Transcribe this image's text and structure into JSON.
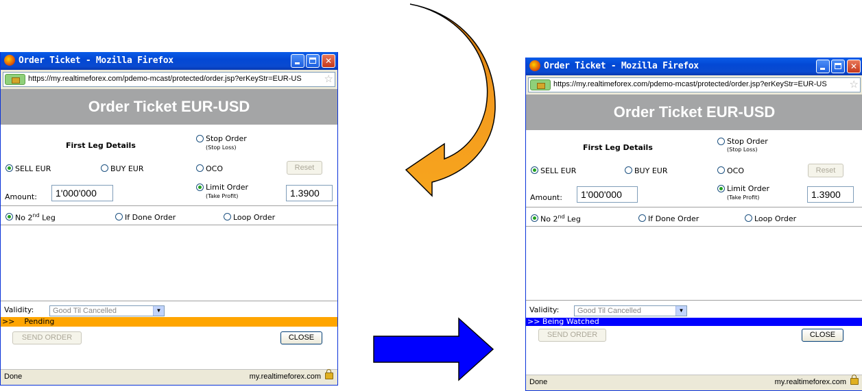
{
  "windows": [
    {
      "window_title": "Order Ticket - Mozilla Firefox",
      "url": "https://my.realtimeforex.com/pdemo-mcast/protected/order.jsp?erKeyStr=EUR-US",
      "header": "Order Ticket EUR-USD",
      "first_leg_label": "First Leg Details",
      "stop_order": "Stop Order",
      "stop_loss": "(Stop Loss)",
      "sell": "SELL EUR",
      "buy": "BUY EUR",
      "oco": "OCO",
      "reset": "Reset",
      "amount_label": "Amount:",
      "amount_value": "1'000'000",
      "limit_order": "Limit Order",
      "take_profit": "(Take Profit)",
      "price_value": "1.3900",
      "no_second_leg": "No 2",
      "no_second_leg_sup": "nd",
      "no_second_leg_tail": " Leg",
      "if_done": "If Done Order",
      "loop_order": "Loop Order",
      "validity_label": "Validity:",
      "validity_value": "Good Til Cancelled",
      "status_text": ">>    Pending",
      "send_order": "SEND ORDER",
      "close": "CLOSE",
      "footer_status": "Done",
      "footer_host": "my.realtimeforex.com"
    },
    {
      "window_title": "Order Ticket - Mozilla Firefox",
      "url": "https://my.realtimeforex.com/pdemo-mcast/protected/order.jsp?erKeyStr=EUR-US",
      "header": "Order Ticket EUR-USD",
      "first_leg_label": "First Leg Details",
      "stop_order": "Stop Order",
      "stop_loss": "(Stop Loss)",
      "sell": "SELL EUR",
      "buy": "BUY EUR",
      "oco": "OCO",
      "reset": "Reset",
      "amount_label": "Amount:",
      "amount_value": "1'000'000",
      "limit_order": "Limit Order",
      "take_profit": "(Take Profit)",
      "price_value": "1.3900",
      "no_second_leg": "No 2",
      "no_second_leg_sup": "nd",
      "no_second_leg_tail": " Leg",
      "if_done": "If Done Order",
      "loop_order": "Loop Order",
      "validity_label": "Validity:",
      "validity_value": "Good Til Cancelled",
      "status_text": ">> Being Watched",
      "send_order": "SEND ORDER",
      "close": "CLOSE",
      "footer_status": "Done",
      "footer_host": "my.realtimeforex.com"
    }
  ],
  "colors": {
    "pending_band": "#ffa500",
    "watched_band": "#0000ff",
    "curved_arrow": "#e08a10",
    "straight_arrow": "#0000ff"
  }
}
